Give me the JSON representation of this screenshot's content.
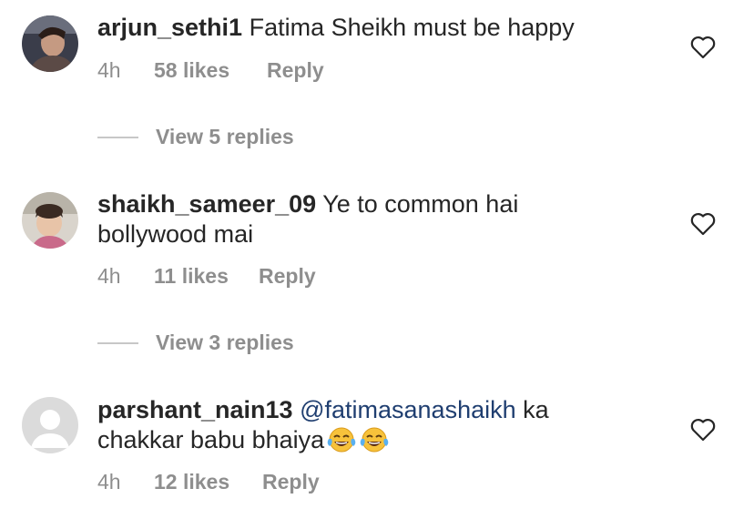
{
  "comments": [
    {
      "username": "arjun_sethi1",
      "text": "Fatima Sheikh must be happy",
      "age": "4h",
      "likes": "58 likes",
      "reply_label": "Reply",
      "view_replies": "View 5 replies"
    },
    {
      "username": "shaikh_sameer_09",
      "text": "Ye to common hai bollywood mai",
      "age": "4h",
      "likes": "11 likes",
      "reply_label": "Reply",
      "view_replies": "View 3 replies"
    },
    {
      "username": "parshant_nain13",
      "mention": "@fatimasanashaikh",
      "text": "ka chakkar babu bhaiya",
      "emoji_icon": "face-with-tears-of-joy-icon",
      "age": "4h",
      "likes": "12 likes",
      "reply_label": "Reply"
    }
  ],
  "colors": {
    "text": "#262626",
    "secondary": "#8e8e8e",
    "mention": "#1f3e70"
  }
}
